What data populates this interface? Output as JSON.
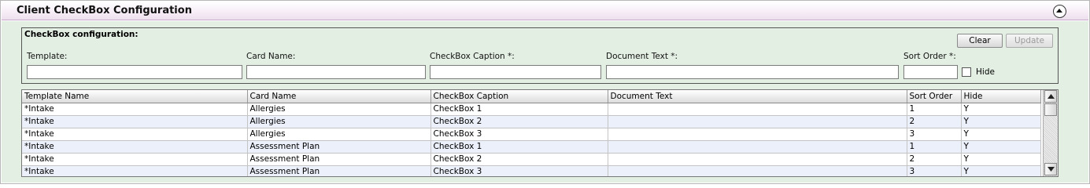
{
  "header": {
    "title": "Client CheckBox Configuration",
    "collapse_icon": "chevron-up-circle-icon"
  },
  "config": {
    "title": "CheckBox configuration:",
    "template_label": "Template:",
    "card_name_label": "Card Name:",
    "caption_label": "CheckBox Caption *:",
    "doc_text_label": "Document Text *:",
    "sort_order_label": "Sort Order *:",
    "template_value": "",
    "card_name_value": "",
    "caption_value": "",
    "doc_text_value": "",
    "sort_order_value": "",
    "hide_label": "Hide",
    "hide_checked": false,
    "clear_label": "Clear",
    "update_label": "Update"
  },
  "grid": {
    "columns": [
      "Template Name",
      "Card Name",
      "CheckBox Caption",
      "Document Text",
      "Sort Order",
      "Hide"
    ],
    "rows": [
      [
        "*Intake",
        "Allergies",
        "CheckBox 1",
        "",
        "1",
        "Y"
      ],
      [
        "*Intake",
        "Allergies",
        "CheckBox 2",
        "",
        "2",
        "Y"
      ],
      [
        "*Intake",
        "Allergies",
        "CheckBox 3",
        "",
        "3",
        "Y"
      ],
      [
        "*Intake",
        "Assessment Plan",
        "CheckBox 1",
        "",
        "1",
        "Y"
      ],
      [
        "*Intake",
        "Assessment Plan",
        "CheckBox 2",
        "",
        "2",
        "Y"
      ],
      [
        "*Intake",
        "Assessment Plan",
        "CheckBox 3",
        "",
        "3",
        "Y"
      ]
    ],
    "scroll_up_icon": "arrow-up-icon",
    "scroll_down_icon": "arrow-down-icon"
  }
}
